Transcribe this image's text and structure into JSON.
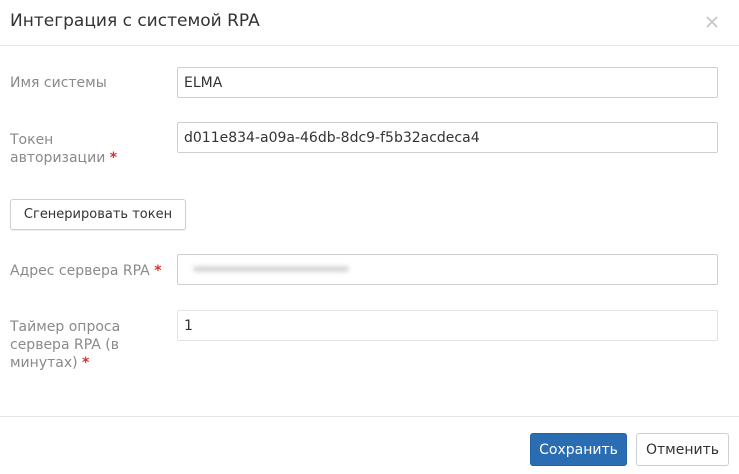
{
  "dialog": {
    "title": "Интеграция с системой RPA",
    "close_icon": "close-icon"
  },
  "form": {
    "system_name": {
      "label": "Имя системы",
      "value": "ELMA"
    },
    "token": {
      "label_line1": "Токен",
      "label_line2": "авторизации",
      "required": "*",
      "value": "d011e834-a09a-46db-8dc9-f5b32acdeca4"
    },
    "generate_button": "Сгенерировать токен",
    "server_address": {
      "label": "Адрес сервера RPA",
      "required": "*",
      "value": ""
    },
    "poll_timer": {
      "label_line1": "Таймер опроса",
      "label_line2": "сервера RPA (в",
      "label_line3": "минутах)",
      "required": "*",
      "value": "1"
    }
  },
  "footer": {
    "save_label": "Сохранить",
    "cancel_label": "Отменить"
  },
  "colors": {
    "primary": "#2a6db3",
    "required": "#d0342c",
    "label": "#8a8a8a"
  }
}
